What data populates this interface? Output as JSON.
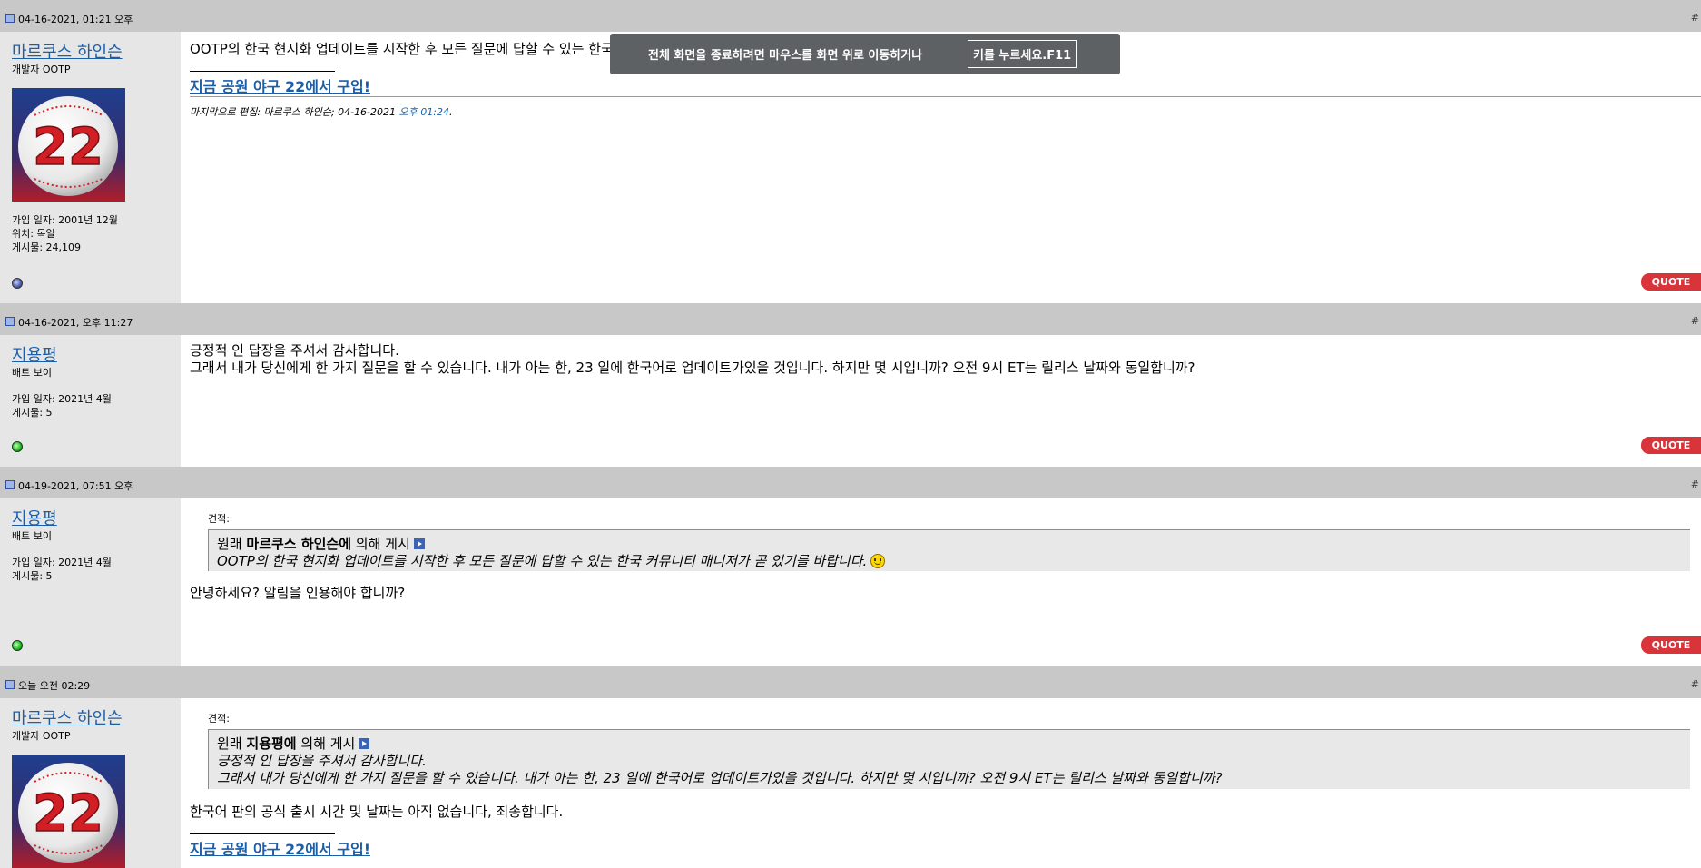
{
  "posts": [
    {
      "date": "04-16-2021, 01:21 오후",
      "username": "마르쿠스 하인슨",
      "user_title": "개발자 OOTP",
      "joined": "가입 일자: 2001년 12월",
      "location": "위치: 독일",
      "post_count": "게시물: 24,109",
      "online": false,
      "message": "OOTP의 한국 현지화 업데이트를 시작한 후 모든 질문에 답할 수 있는 한국 커뮤니티 매니저가 곧 있기를 바랍니다.",
      "signature": "지금 공원 야구 22에서 구입!",
      "edited_prefix": "마지막으로 편집: 마르쿠스 하인슨; 04-16-2021",
      "edited_time": "오후 01:24",
      "quote_label": "QUOTE"
    },
    {
      "date": "04-16-2021, 오후 11:27",
      "username": "지용평",
      "user_title": "배트 보이",
      "joined": "가입 일자: 2021년 4월",
      "post_count": "게시물: 5",
      "online": true,
      "message_line1": "긍정적 인 답장을 주셔서 감사합니다.",
      "message_line2": "그래서 내가 당신에게 한 가지 질문을 할 수 있습니다. 내가 아는 한, 23 일에 한국어로 업데이트가있을 것입니다. 하지만 몇 시입니까? 오전 9시 ET는 릴리스 날짜와 동일합니까?",
      "quote_label": "QUOTE"
    },
    {
      "date": "04-19-2021, 07:51 오후",
      "username": "지용평",
      "user_title": "배트 보이",
      "joined": "가입 일자: 2021년 4월",
      "post_count": "게시물: 5",
      "online": true,
      "quote_header": "견적:",
      "quote_orig_prefix": "원래",
      "quote_orig_author": "마르쿠스 하인슨에",
      "quote_orig_suffix": "의해 게시",
      "quote_text": "OOTP의 한국 현지화 업데이트를 시작한 후 모든 질문에 답할 수 있는 한국 커뮤니티 매니저가 곧 있기를 바랍니다.",
      "message": "안녕하세요? 알림을 인용해야 합니까?",
      "quote_label": "QUOTE"
    },
    {
      "date": "오늘 오전 02:29",
      "username": "마르쿠스 하인슨",
      "user_title": "개발자 OOTP",
      "quote_header": "견적:",
      "quote_orig_prefix": "원래",
      "quote_orig_author": "지용평에",
      "quote_orig_suffix": "의해 게시",
      "quote_line1": "긍정적 인 답장을 주셔서 감사합니다.",
      "quote_line2": "그래서 내가 당신에게 한 가지 질문을 할 수 있습니다. 내가 아는 한, 23 일에 한국어로 업데이트가있을 것입니다. 하지만 몇 시입니까? 오전 9시 ET는 릴리스 날짜와 동일합니까?",
      "message": "한국어 판의 공식 출시 시간 및 날짜는 아직 없습니다, 죄송합니다.",
      "signature": "지금 공원 야구 22에서 구입!"
    }
  ],
  "avatar_number": "22",
  "fullscreen_toast": {
    "text": "전체 화면을 종료하려면 마우스를 화면 위로 이동하거나",
    "key_text": "키를 누르세요.F11"
  },
  "colors": {
    "header_bg": "#c8c8c8",
    "sidebar_bg": "#e6e6e6",
    "link": "#1b5fa8",
    "quote_button": "#d8343a"
  }
}
